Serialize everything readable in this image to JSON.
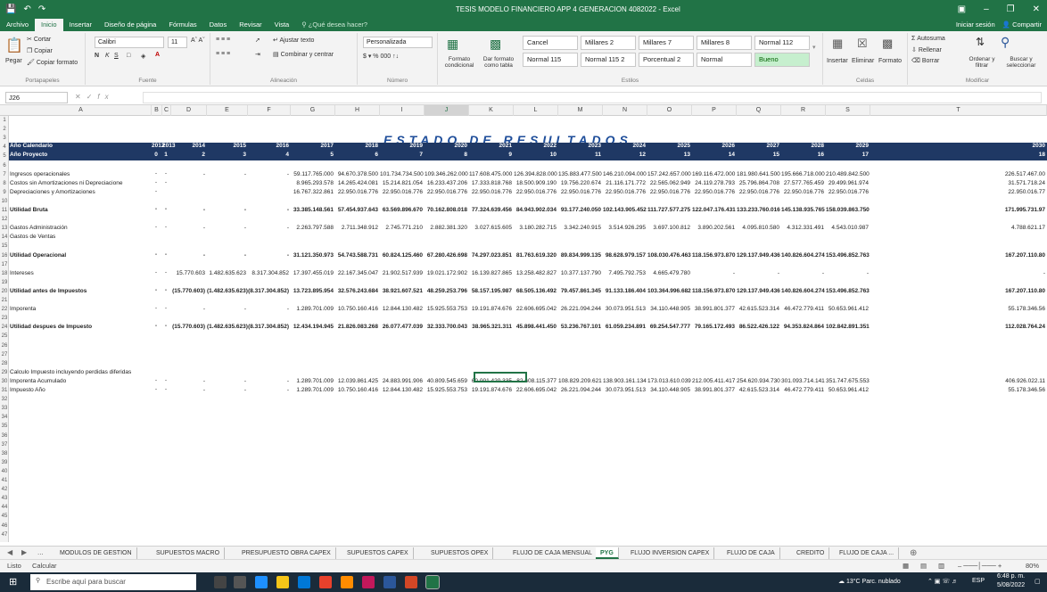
{
  "window": {
    "title": "TESIS MODELO FINANCIERO APP 4 GENERACION 4082022 - Excel"
  },
  "menu": {
    "tabs": [
      "Archivo",
      "Inicio",
      "Insertar",
      "Diseño de página",
      "Fórmulas",
      "Datos",
      "Revisar",
      "Vista"
    ],
    "tell_me": "¿Qué desea hacer?",
    "signin": "Iniciar sesión",
    "share": "Compartir"
  },
  "ribbon": {
    "clipboard": {
      "paste": "Pegar",
      "cut": "Cortar",
      "copy": "Copiar",
      "format_painter": "Copiar formato",
      "label": "Portapapeles"
    },
    "font": {
      "name": "Calibri",
      "size": "11",
      "label": "Fuente"
    },
    "alignment": {
      "wrap": "Ajustar texto",
      "merge": "Combinar y centrar",
      "label": "Alineación"
    },
    "number": {
      "format": "Personalizada",
      "label": "Número"
    },
    "styles": {
      "cond": "Formato condicional",
      "table": "Dar formato como tabla",
      "cells": [
        "Cancel",
        "Millares 2",
        "Millares 7",
        "Millares 8",
        "Normal 112",
        "Normal 115",
        "Normal 115 2",
        "Porcentual 2",
        "Normal",
        "Bueno"
      ],
      "label": "Estilos"
    },
    "cells": {
      "insert": "Insertar",
      "delete": "Eliminar",
      "format": "Formato",
      "label": "Celdas"
    },
    "editing": {
      "autosum": "Autosuma",
      "fill": "Rellenar",
      "clear": "Borrar",
      "sort": "Ordenar y filtrar",
      "find": "Buscar y seleccionar",
      "label": "Modificar"
    }
  },
  "formula_bar": {
    "name_box": "J26",
    "fx": "fx",
    "value": ""
  },
  "columns": [
    "A",
    "B",
    "C",
    "D",
    "E",
    "F",
    "G",
    "H",
    "I",
    "J",
    "K",
    "L",
    "M",
    "N",
    "O",
    "P",
    "Q",
    "R",
    "S",
    "T"
  ],
  "report": {
    "title": "ESTADO DE RESULTADOS",
    "year_label": "Año Calendario",
    "period_label": "Año Proyecto",
    "years": [
      "2012",
      "2013",
      "2014",
      "2015",
      "2016",
      "2017",
      "2018",
      "2019",
      "2020",
      "2021",
      "2022",
      "2023",
      "2024",
      "2025",
      "2026",
      "2027",
      "2028",
      "2029",
      "2030"
    ],
    "periods": [
      "0",
      "1",
      "2",
      "3",
      "4",
      "5",
      "6",
      "7",
      "8",
      "9",
      "10",
      "11",
      "12",
      "13",
      "14",
      "15",
      "16",
      "17",
      "18"
    ],
    "rows": [
      {
        "row": 7,
        "label": "Ingresos operacionales",
        "bold": false,
        "values": [
          "-",
          "-",
          "-",
          "-",
          "-",
          "59.117.765.000",
          "94.670.378.500",
          "101.734.734.500",
          "109.346.262.000",
          "117.608.475.000",
          "126.394.828.000",
          "135.883.477.500",
          "146.210.094.000",
          "157.242.657.000",
          "169.116.472.000",
          "181.980.641.500",
          "195.666.718.000",
          "210.489.842.500",
          "226.517.467.00"
        ]
      },
      {
        "row": 8,
        "label": "Costos sin Amortizaciones ni Depreciacione",
        "bold": false,
        "values": [
          "-",
          "-",
          "",
          "",
          "",
          "8.965.293.578",
          "14.265.424.081",
          "15.214.821.054",
          "16.233.437.206",
          "17.333.818.768",
          "18.500.909.190",
          "19.756.220.674",
          "21.116.171.772",
          "22.565.062.949",
          "24.119.278.793",
          "25.796.864.708",
          "27.577.765.459",
          "29.499.961.974",
          "31.571.718.24"
        ]
      },
      {
        "row": 9,
        "label": "Depreciaciones y Amortizaciones",
        "bold": false,
        "values": [
          "-",
          "",
          "",
          "",
          "",
          "16.767.322.861",
          "22.950.016.776",
          "22.950.016.776",
          "22.950.016.776",
          "22.950.016.776",
          "22.950.016.776",
          "22.950.016.776",
          "22.950.016.776",
          "22.950.016.776",
          "22.950.016.776",
          "22.950.016.776",
          "22.950.016.776",
          "22.950.016.776",
          "22.950.016.77"
        ]
      },
      {
        "row": 11,
        "label": "Utilidad Bruta",
        "bold": true,
        "values": [
          "-",
          "-",
          "-",
          "-",
          "-",
          "33.385.148.561",
          "57.454.937.643",
          "63.569.896.670",
          "70.162.808.018",
          "77.324.639.456",
          "84.943.902.034",
          "93.177.240.050",
          "102.143.905.452",
          "111.727.577.275",
          "122.047.176.431",
          "133.233.760.016",
          "145.138.935.765",
          "158.039.863.750",
          "171.995.731.97"
        ]
      },
      {
        "row": 13,
        "label": "Gastos Administración",
        "bold": false,
        "values": [
          "-",
          "-",
          "-",
          "-",
          "-",
          "2.263.797.588",
          "2.711.348.912",
          "2.745.771.210",
          "2.882.381.320",
          "3.027.615.605",
          "3.180.282.715",
          "3.342.240.915",
          "3.514.926.295",
          "3.697.100.812",
          "3.890.202.561",
          "4.095.810.580",
          "4.312.331.491",
          "4.543.010.987",
          "4.788.621.17"
        ]
      },
      {
        "row": 14,
        "label": "Gastos de Ventas",
        "bold": false,
        "values": [
          "",
          "",
          "",
          "",
          "",
          "",
          "",
          "",
          "",
          "",
          "",
          "",
          "",
          "",
          "",
          "",
          "",
          "",
          ""
        ]
      },
      {
        "row": 16,
        "label": "Utilidad Operacional",
        "bold": true,
        "values": [
          "-",
          "-",
          "-",
          "-",
          "-",
          "31.121.350.973",
          "54.743.588.731",
          "60.824.125.460",
          "67.280.426.698",
          "74.297.023.851",
          "81.763.619.320",
          "89.834.999.135",
          "98.628.979.157",
          "108.030.476.463",
          "118.156.973.870",
          "129.137.949.436",
          "140.826.604.274",
          "153.496.852.763",
          "167.207.110.80"
        ]
      },
      {
        "row": 18,
        "label": "Intereses",
        "bold": false,
        "values": [
          "-",
          "-",
          "15.770.603",
          "1.482.635.623",
          "8.317.304.852",
          "17.397.455.019",
          "22.167.345.047",
          "21.902.517.939",
          "19.021.172.902",
          "16.139.827.865",
          "13.258.482.827",
          "10.377.137.790",
          "7.495.792.753",
          "4.665.479.780",
          "-",
          "-",
          "-",
          "-",
          "-"
        ]
      },
      {
        "row": 20,
        "label": "Utilidad antes de Impuestos",
        "bold": true,
        "values": [
          "-",
          "-",
          "(15.770.603)",
          "(1.482.635.623)",
          "(8.317.304.852)",
          "13.723.895.954",
          "32.576.243.684",
          "38.921.607.521",
          "48.259.253.796",
          "58.157.195.987",
          "68.505.136.492",
          "79.457.861.345",
          "91.133.186.404",
          "103.364.996.682",
          "118.156.973.870",
          "129.137.949.436",
          "140.826.604.274",
          "153.496.852.763",
          "167.207.110.80"
        ]
      },
      {
        "row": 22,
        "label": "Imporenta",
        "bold": false,
        "values": [
          "-",
          "-",
          "-",
          "-",
          "-",
          "1.289.701.009",
          "10.750.160.416",
          "12.844.130.482",
          "15.925.553.753",
          "19.191.874.676",
          "22.606.695.042",
          "26.221.094.244",
          "30.073.951.513",
          "34.110.448.905",
          "38.991.801.377",
          "42.615.523.314",
          "46.472.779.411",
          "50.653.961.412",
          "55.178.346.56"
        ]
      },
      {
        "row": 24,
        "label": "Utilidad despues de Impuesto",
        "bold": true,
        "values": [
          "-",
          "-",
          "(15.770.603)",
          "(1.482.635.623)",
          "(8.317.304.852)",
          "12.434.194.945",
          "21.826.083.268",
          "26.077.477.039",
          "32.333.700.043",
          "38.965.321.311",
          "45.898.441.450",
          "53.236.767.101",
          "61.059.234.891",
          "69.254.547.777",
          "79.165.172.493",
          "86.522.426.122",
          "94.353.824.864",
          "102.842.891.351",
          "112.028.764.24"
        ]
      },
      {
        "row": 29,
        "label": "Calculo Impuesto incluyendo perdidas diferidas",
        "bold": false,
        "values": [
          "",
          "",
          "",
          "",
          "",
          "",
          "",
          "",
          "",
          "",
          "",
          "",
          "",
          "",
          "",
          "",
          "",
          "",
          ""
        ]
      },
      {
        "row": 30,
        "label": "Imporenta Acumulado",
        "bold": false,
        "values": [
          "-",
          "-",
          "-",
          "-",
          "-",
          "1.289.701.009",
          "12.039.861.425",
          "24.883.991.906",
          "40.809.545.659",
          "60.001.420.335",
          "82.608.115.377",
          "108.829.209.621",
          "138.903.161.134",
          "173.013.610.039",
          "212.005.411.417",
          "254.620.934.730",
          "301.093.714.141",
          "351.747.675.553",
          "406.926.022.11"
        ]
      },
      {
        "row": 31,
        "label": "Impuesto Año",
        "bold": false,
        "values": [
          "-",
          "-",
          "-",
          "-",
          "-",
          "1.289.701.009",
          "10.750.160.416",
          "12.844.130.482",
          "15.925.553.753",
          "19.191.874.676",
          "22.606.695.042",
          "26.221.094.244",
          "30.073.951.513",
          "34.110.448.905",
          "38.991.801.377",
          "42.615.523.314",
          "46.472.779.411",
          "50.653.961.412",
          "55.178.346.56"
        ]
      }
    ]
  },
  "sheet_tabs": [
    "MODULOS DE GESTION",
    "SUPUESTOS MACRO",
    "PRESUPUESTO OBRA CAPEX",
    "SUPUESTOS CAPEX",
    "SUPUESTOS OPEX",
    "FLUJO DE CAJA MENSUAL",
    "PYG",
    "FLUJO INVERSION CAPEX",
    "FLUJO DE CAJA",
    "CREDITO",
    "FLUJO DE CAJA ..."
  ],
  "active_tab": "PYG",
  "status": {
    "mode": "Listo",
    "calc": "Calcular",
    "zoom": "80%"
  },
  "taskbar": {
    "search_placeholder": "Escribe aquí para buscar",
    "weather": "13°C Parc. nublado",
    "lang": "ESP",
    "time": "6:48 p. m.",
    "date": "5/08/2022"
  }
}
